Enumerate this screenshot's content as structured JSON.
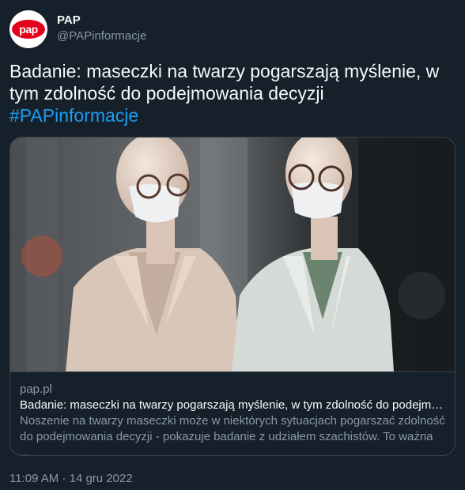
{
  "author": {
    "display_name": "PAP",
    "handle": "@PAPinformacje",
    "logo_text": "pap"
  },
  "tweet": {
    "text": "Badanie: maseczki na twarzy pogarszają myślenie, w tym zdolność do podejmowania decyzji",
    "hashtag": "#PAPinformacje"
  },
  "card": {
    "domain": "pap.pl",
    "title": "Badanie: maseczki na twarzy pogarszają myślenie, w tym zdolność do podejmo...",
    "description_line1": "Noszenie na twarzy maseczki może w niektórych sytuacjach pogarszać zdolność",
    "description_line2": "do podejmowania decyzji - pokazuje badanie z udziałem szachistów. To ważna ..."
  },
  "timestamp": "11:09 AM · 14 gru 2022",
  "colors": {
    "background": "#15202b",
    "hashtag": "#1d9bf0",
    "logo_red": "#e3001b",
    "muted_text": "#8b98a5",
    "border": "#38444d"
  }
}
